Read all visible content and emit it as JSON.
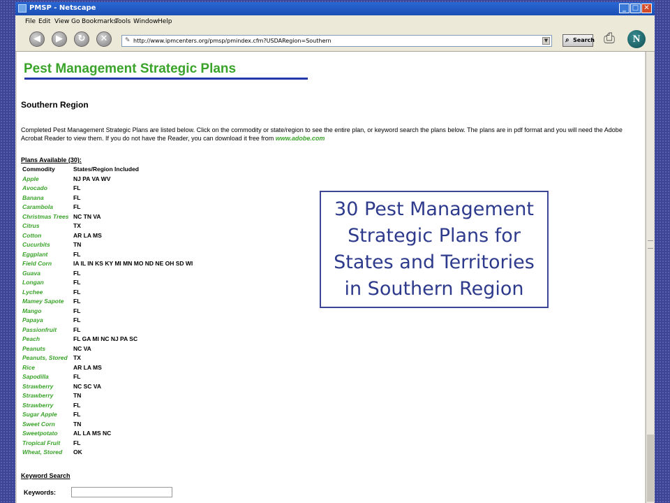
{
  "window": {
    "title": "PMSP - Netscape",
    "controls": {
      "minimize": "_",
      "maximize": "□",
      "close": "✕"
    }
  },
  "menu": [
    "File",
    "Edit",
    "View",
    "Go",
    "Bookmarks",
    "Tools",
    "Window",
    "Help"
  ],
  "toolbar": {
    "url": "http://www.ipmcenters.org/pmsp/pmindex.cfm?USDARegion=Southern",
    "search_label": "Search",
    "nav_icons": [
      "back-icon",
      "forward-icon",
      "reload-icon",
      "stop-icon"
    ]
  },
  "page": {
    "title": "Pest Management Strategic Plans",
    "region_heading": "Southern Region",
    "intro_text": "Completed Pest Management Strategic Plans are listed below. Click on the commodity or state/region to see the entire plan, or keyword search the plans below. The plans are in pdf format and you will need the Adobe Acrobat Reader to view them. If you do not have the Reader, you can download it free from ",
    "adobe_link": "www.adobe.com",
    "plans_heading": "Plans Available (30):",
    "table_headers": {
      "commodity": "Commodity",
      "states": "States/Region Included"
    },
    "plans": [
      {
        "commodity": "Apple",
        "states": "NJ PA VA WV"
      },
      {
        "commodity": "Avocado",
        "states": "FL"
      },
      {
        "commodity": "Banana",
        "states": "FL"
      },
      {
        "commodity": "Carambola",
        "states": "FL"
      },
      {
        "commodity": "Christmas Trees",
        "states": "NC TN VA"
      },
      {
        "commodity": "Citrus",
        "states": "TX"
      },
      {
        "commodity": "Cotton",
        "states": "AR LA MS"
      },
      {
        "commodity": "Cucurbits",
        "states": "TN"
      },
      {
        "commodity": "Eggplant",
        "states": "FL"
      },
      {
        "commodity": "Field Corn",
        "states": "IA IL IN KS KY MI MN MO ND NE OH SD WI"
      },
      {
        "commodity": "Guava",
        "states": "FL"
      },
      {
        "commodity": "Longan",
        "states": "FL"
      },
      {
        "commodity": "Lychee",
        "states": "FL"
      },
      {
        "commodity": "Mamey Sapote",
        "states": "FL"
      },
      {
        "commodity": "Mango",
        "states": "FL"
      },
      {
        "commodity": "Papaya",
        "states": "FL"
      },
      {
        "commodity": "Passionfruit",
        "states": "FL"
      },
      {
        "commodity": "Peach",
        "states": "FL GA MI NC NJ PA SC"
      },
      {
        "commodity": "Peanuts",
        "states": "NC VA"
      },
      {
        "commodity": "Peanuts, Stored",
        "states": "TX"
      },
      {
        "commodity": "Rice",
        "states": "AR LA MS"
      },
      {
        "commodity": "Sapodilla",
        "states": "FL"
      },
      {
        "commodity": "Strawberry",
        "states": "NC SC VA"
      },
      {
        "commodity": "Strawberry",
        "states": "TN"
      },
      {
        "commodity": "Strawberry",
        "states": "FL"
      },
      {
        "commodity": "Sugar Apple",
        "states": "FL"
      },
      {
        "commodity": "Sweet Corn",
        "states": "TN"
      },
      {
        "commodity": "Sweetpotato",
        "states": "AL LA MS NC"
      },
      {
        "commodity": "Tropical Fruit",
        "states": "FL"
      },
      {
        "commodity": "Wheat, Stored",
        "states": "OK"
      }
    ],
    "keyword_heading": "Keyword Search",
    "keywords_label": "Keywords:"
  },
  "callout": {
    "lines": [
      "30 Pest Management",
      "Strategic Plans for",
      "States and Territories",
      "in Southern Region"
    ]
  },
  "colors": {
    "slide_background": "#3d4597",
    "title_green": "#3aa32a",
    "rule_blue": "#2438a8",
    "callout_text": "#2e3a8c"
  }
}
